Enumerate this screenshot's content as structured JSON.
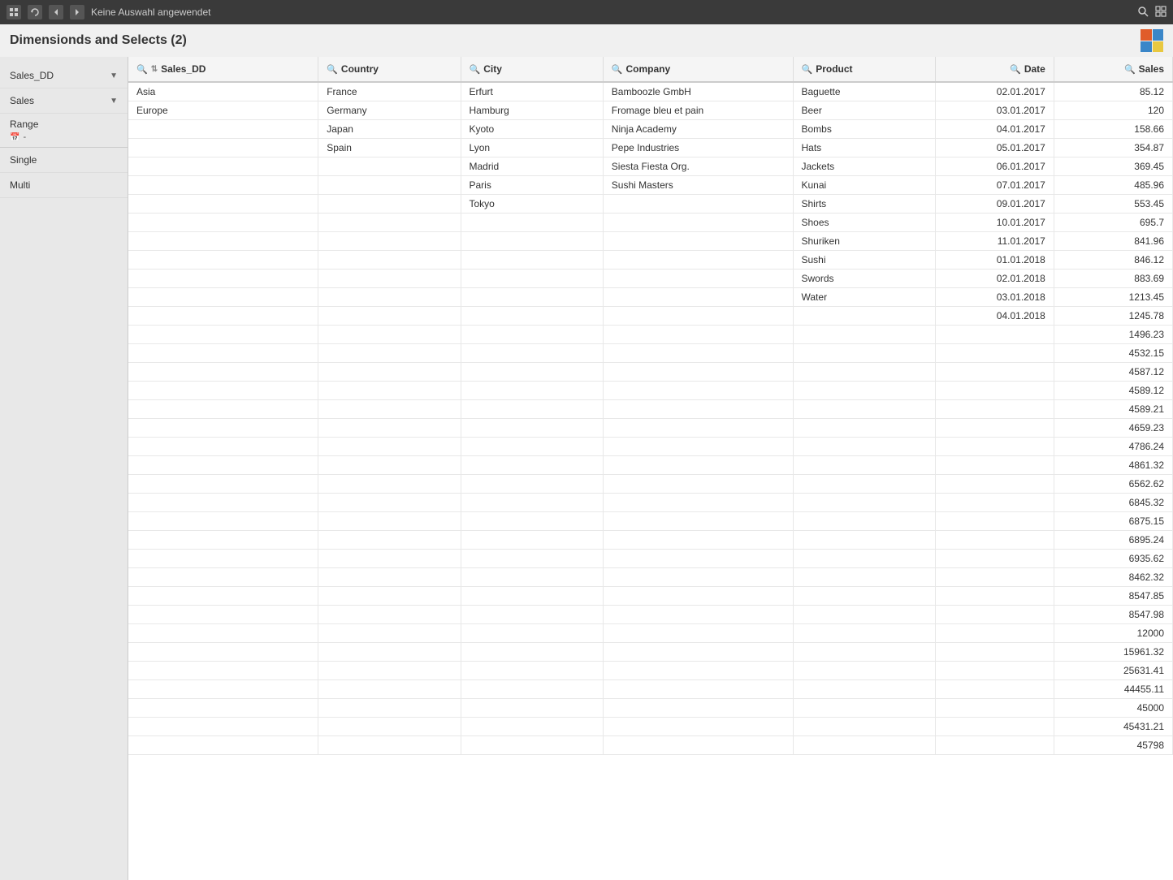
{
  "topbar": {
    "icons": [
      "refresh-icon",
      "back-icon",
      "forward-icon"
    ],
    "title": "Keine Auswahl angewendet",
    "search_icon": "search-icon",
    "expand_icon": "expand-icon"
  },
  "page": {
    "title": "Dimensionds and Selects (2)"
  },
  "sidebar": {
    "items": [
      {
        "label": "Sales_DD",
        "has_chevron": true
      },
      {
        "label": "Sales",
        "has_chevron": true
      },
      {
        "label": "Range",
        "has_sub": true,
        "sub": "📅 -"
      },
      {
        "label": "Single"
      },
      {
        "label": "Multi"
      }
    ]
  },
  "columns": [
    {
      "key": "salesdd",
      "label": "Sales_DD",
      "has_search": true,
      "has_sort": true
    },
    {
      "key": "country",
      "label": "Country",
      "has_search": true
    },
    {
      "key": "city",
      "label": "City",
      "has_search": true
    },
    {
      "key": "company",
      "label": "Company",
      "has_search": true
    },
    {
      "key": "product",
      "label": "Product",
      "has_search": true
    },
    {
      "key": "date",
      "label": "Date",
      "has_search": true
    },
    {
      "key": "sales",
      "label": "Sales",
      "has_search": true
    }
  ],
  "rows": [
    {
      "salesdd": "Asia",
      "country": "France",
      "city": "Erfurt",
      "company": "Bamboozle GmbH",
      "product": "Baguette",
      "date": "02.01.2017",
      "sales": "85.12"
    },
    {
      "salesdd": "Europe",
      "country": "Germany",
      "city": "Hamburg",
      "company": "Fromage bleu et pain",
      "product": "Beer",
      "date": "03.01.2017",
      "sales": "120"
    },
    {
      "salesdd": "",
      "country": "Japan",
      "city": "Kyoto",
      "company": "Ninja Academy",
      "product": "Bombs",
      "date": "04.01.2017",
      "sales": "158.66"
    },
    {
      "salesdd": "",
      "country": "Spain",
      "city": "Lyon",
      "company": "Pepe Industries",
      "product": "Hats",
      "date": "05.01.2017",
      "sales": "354.87"
    },
    {
      "salesdd": "",
      "country": "",
      "city": "Madrid",
      "company": "Siesta Fiesta Org.",
      "product": "Jackets",
      "date": "06.01.2017",
      "sales": "369.45"
    },
    {
      "salesdd": "",
      "country": "",
      "city": "Paris",
      "company": "Sushi Masters",
      "product": "Kunai",
      "date": "07.01.2017",
      "sales": "485.96"
    },
    {
      "salesdd": "",
      "country": "",
      "city": "Tokyo",
      "company": "",
      "product": "Shirts",
      "date": "09.01.2017",
      "sales": "553.45"
    },
    {
      "salesdd": "",
      "country": "",
      "city": "",
      "company": "",
      "product": "Shoes",
      "date": "10.01.2017",
      "sales": "695.7"
    },
    {
      "salesdd": "",
      "country": "",
      "city": "",
      "company": "",
      "product": "Shuriken",
      "date": "11.01.2017",
      "sales": "841.96"
    },
    {
      "salesdd": "",
      "country": "",
      "city": "",
      "company": "",
      "product": "Sushi",
      "date": "01.01.2018",
      "sales": "846.12"
    },
    {
      "salesdd": "",
      "country": "",
      "city": "",
      "company": "",
      "product": "Swords",
      "date": "02.01.2018",
      "sales": "883.69"
    },
    {
      "salesdd": "",
      "country": "",
      "city": "",
      "company": "",
      "product": "Water",
      "date": "03.01.2018",
      "sales": "1213.45"
    },
    {
      "salesdd": "",
      "country": "",
      "city": "",
      "company": "",
      "product": "",
      "date": "04.01.2018",
      "sales": "1245.78"
    },
    {
      "salesdd": "",
      "country": "",
      "city": "",
      "company": "",
      "product": "",
      "date": "",
      "sales": "1496.23"
    },
    {
      "salesdd": "",
      "country": "",
      "city": "",
      "company": "",
      "product": "",
      "date": "",
      "sales": "4532.15"
    },
    {
      "salesdd": "",
      "country": "",
      "city": "",
      "company": "",
      "product": "",
      "date": "",
      "sales": "4587.12"
    },
    {
      "salesdd": "",
      "country": "",
      "city": "",
      "company": "",
      "product": "",
      "date": "",
      "sales": "4589.12"
    },
    {
      "salesdd": "",
      "country": "",
      "city": "",
      "company": "",
      "product": "",
      "date": "",
      "sales": "4589.21"
    },
    {
      "salesdd": "",
      "country": "",
      "city": "",
      "company": "",
      "product": "",
      "date": "",
      "sales": "4659.23"
    },
    {
      "salesdd": "",
      "country": "",
      "city": "",
      "company": "",
      "product": "",
      "date": "",
      "sales": "4786.24"
    },
    {
      "salesdd": "",
      "country": "",
      "city": "",
      "company": "",
      "product": "",
      "date": "",
      "sales": "4861.32"
    },
    {
      "salesdd": "",
      "country": "",
      "city": "",
      "company": "",
      "product": "",
      "date": "",
      "sales": "6562.62"
    },
    {
      "salesdd": "",
      "country": "",
      "city": "",
      "company": "",
      "product": "",
      "date": "",
      "sales": "6845.32"
    },
    {
      "salesdd": "",
      "country": "",
      "city": "",
      "company": "",
      "product": "",
      "date": "",
      "sales": "6875.15"
    },
    {
      "salesdd": "",
      "country": "",
      "city": "",
      "company": "",
      "product": "",
      "date": "",
      "sales": "6895.24"
    },
    {
      "salesdd": "",
      "country": "",
      "city": "",
      "company": "",
      "product": "",
      "date": "",
      "sales": "6935.62"
    },
    {
      "salesdd": "",
      "country": "",
      "city": "",
      "company": "",
      "product": "",
      "date": "",
      "sales": "8462.32"
    },
    {
      "salesdd": "",
      "country": "",
      "city": "",
      "company": "",
      "product": "",
      "date": "",
      "sales": "8547.85"
    },
    {
      "salesdd": "",
      "country": "",
      "city": "",
      "company": "",
      "product": "",
      "date": "",
      "sales": "8547.98"
    },
    {
      "salesdd": "",
      "country": "",
      "city": "",
      "company": "",
      "product": "",
      "date": "",
      "sales": "12000"
    },
    {
      "salesdd": "",
      "country": "",
      "city": "",
      "company": "",
      "product": "",
      "date": "",
      "sales": "15961.32"
    },
    {
      "salesdd": "",
      "country": "",
      "city": "",
      "company": "",
      "product": "",
      "date": "",
      "sales": "25631.41"
    },
    {
      "salesdd": "",
      "country": "",
      "city": "",
      "company": "",
      "product": "",
      "date": "",
      "sales": "44455.11"
    },
    {
      "salesdd": "",
      "country": "",
      "city": "",
      "company": "",
      "product": "",
      "date": "",
      "sales": "45000"
    },
    {
      "salesdd": "",
      "country": "",
      "city": "",
      "company": "",
      "product": "",
      "date": "",
      "sales": "45431.21"
    },
    {
      "salesdd": "",
      "country": "",
      "city": "",
      "company": "",
      "product": "",
      "date": "",
      "sales": "45798"
    }
  ]
}
